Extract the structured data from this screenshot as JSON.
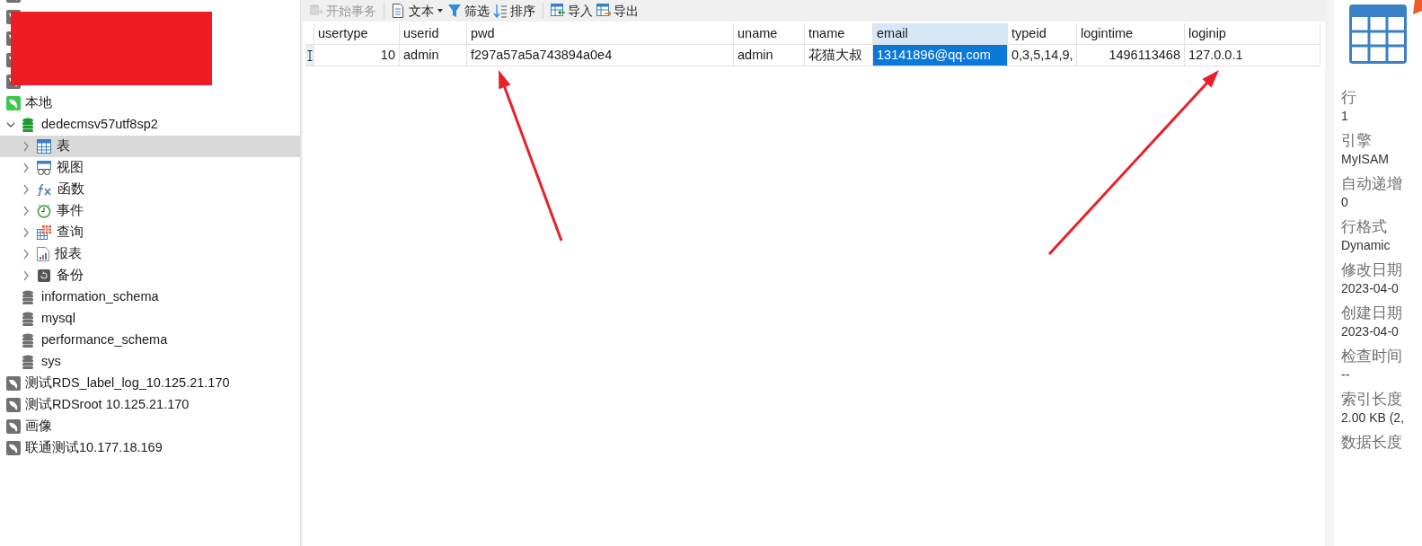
{
  "toolbar": {
    "buttons": [
      {
        "label": "开始事务",
        "kind": "transaction",
        "disabled": true
      },
      {
        "label": "文本",
        "kind": "text",
        "disabled": false,
        "dropdown": true,
        "group_start": true
      },
      {
        "label": "筛选",
        "kind": "filter",
        "disabled": false
      },
      {
        "label": "排序",
        "kind": "sort",
        "disabled": false
      },
      {
        "label": "导入",
        "kind": "import",
        "disabled": false,
        "group_start": true
      },
      {
        "label": "导出",
        "kind": "export",
        "disabled": false
      }
    ]
  },
  "sidebar": {
    "redacted_rows": [
      {
        "kind": "connection"
      },
      {
        "kind": "connection"
      },
      {
        "kind": "connection"
      },
      {
        "kind": "connection"
      },
      {
        "kind": "connection"
      }
    ],
    "items": [
      {
        "kind": "connection",
        "label": "本地",
        "connected": true,
        "children": [
          {
            "kind": "database",
            "label": "dedecmsv57utf8sp2",
            "open": true,
            "expanded": true,
            "children": [
              {
                "kind": "tables",
                "label": "表",
                "selected": true
              },
              {
                "kind": "views",
                "label": "视图",
                "selected": false
              },
              {
                "kind": "functions",
                "label": "函数",
                "selected": false
              },
              {
                "kind": "events",
                "label": "事件",
                "selected": false
              },
              {
                "kind": "queries",
                "label": "查询",
                "selected": false
              },
              {
                "kind": "reports",
                "label": "报表",
                "selected": false
              },
              {
                "kind": "backups",
                "label": "备份",
                "selected": false
              }
            ]
          },
          {
            "kind": "database",
            "label": "information_schema",
            "open": false
          },
          {
            "kind": "database",
            "label": "mysql",
            "open": false
          },
          {
            "kind": "database",
            "label": "performance_schema",
            "open": false
          },
          {
            "kind": "database",
            "label": "sys",
            "open": false
          }
        ]
      },
      {
        "kind": "connection",
        "label": "测试RDS_label_log_10.125.21.170",
        "connected": false
      },
      {
        "kind": "connection",
        "label": "测试RDSroot 10.125.21.170",
        "connected": false
      },
      {
        "kind": "connection",
        "label": "画像",
        "connected": false
      },
      {
        "kind": "connection",
        "label": "联通测试10.177.18.169",
        "connected": false
      }
    ]
  },
  "table": {
    "columns": [
      {
        "label": "usertype",
        "selected": false,
        "numeric": true
      },
      {
        "label": "userid",
        "selected": false,
        "numeric": false
      },
      {
        "label": "pwd",
        "selected": false,
        "numeric": false
      },
      {
        "label": "uname",
        "selected": false,
        "numeric": false
      },
      {
        "label": "tname",
        "selected": false,
        "numeric": false
      },
      {
        "label": "email",
        "selected": true,
        "numeric": false
      },
      {
        "label": "typeid",
        "selected": false,
        "numeric": false
      },
      {
        "label": "logintime",
        "selected": false,
        "numeric": true
      },
      {
        "label": "loginip",
        "selected": false,
        "numeric": false
      }
    ],
    "rows": [
      {
        "current": true,
        "cells": [
          {
            "text": "10",
            "selected": false
          },
          {
            "text": "admin",
            "selected": false
          },
          {
            "text": "f297a57a5a743894a0e4",
            "selected": false
          },
          {
            "text": "admin",
            "selected": false
          },
          {
            "text": "花猫大叔",
            "selected": false
          },
          {
            "text": "13141896@qq.com",
            "selected": true
          },
          {
            "text": "0,3,5,14,9,",
            "selected": false
          },
          {
            "text": "1496113468",
            "selected": false
          },
          {
            "text": "127.0.0.1",
            "selected": false
          }
        ]
      }
    ]
  },
  "info_panel": {
    "fields": [
      {
        "label": "行",
        "value": "1"
      },
      {
        "label": "引擎",
        "value": "MyISAM"
      },
      {
        "label": "自动递增",
        "value": "0"
      },
      {
        "label": "行格式",
        "value": "Dynamic"
      },
      {
        "label": "修改日期",
        "value": "2023-04-0"
      },
      {
        "label": "创建日期",
        "value": "2023-04-0"
      },
      {
        "label": "检查时间",
        "value": "--"
      },
      {
        "label": "索引长度",
        "value": "2.00 KB (2,"
      },
      {
        "label": "数据长度"
      }
    ]
  }
}
